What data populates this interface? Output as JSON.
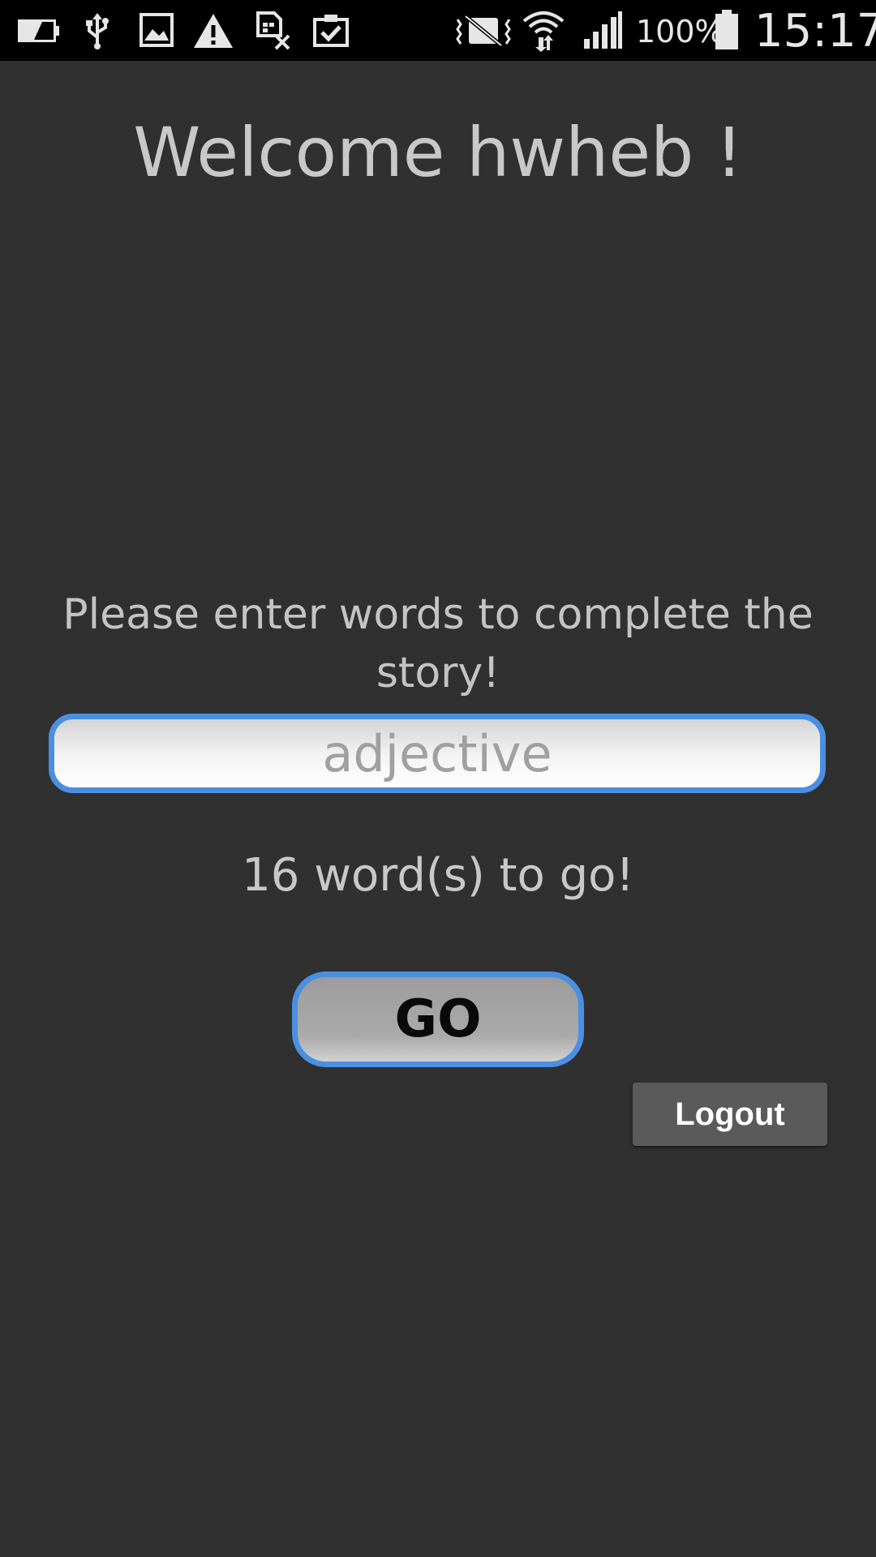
{
  "status_bar": {
    "icons_left": [
      "battery-low-icon",
      "usb-icon",
      "image-icon",
      "warning-icon",
      "sim-off-icon",
      "clipboard-check-icon"
    ],
    "icons_right": [
      "vibrate-mute-icon",
      "wifi-icon",
      "signal-icon",
      "battery-icon"
    ],
    "battery_percent": "100%",
    "time": "15:17"
  },
  "welcome": {
    "title": "Welcome hwheb !"
  },
  "story": {
    "instructions": "Please enter words to complete the story!",
    "input_placeholder": "adjective",
    "input_value": "",
    "words_remaining": "16 word(s) to go!"
  },
  "actions": {
    "go_label": "GO",
    "logout_label": "Logout"
  },
  "colors": {
    "background": "#303030",
    "accent": "#4a90e2",
    "text": "#c8c8c8"
  }
}
